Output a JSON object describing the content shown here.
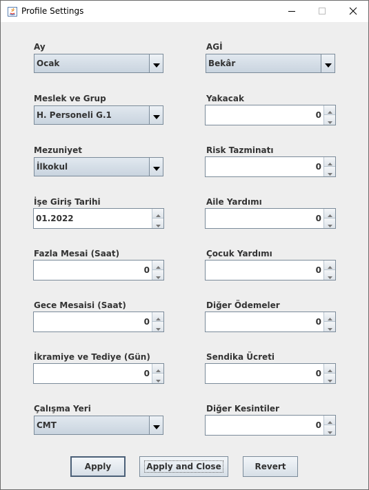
{
  "window": {
    "title": "Profile Settings"
  },
  "fields": {
    "ay": {
      "label": "Ay",
      "value": "Ocak"
    },
    "agi": {
      "label": "AGİ",
      "value": "Bekâr"
    },
    "meslek": {
      "label": "Meslek ve Grup",
      "value": "H. Personeli G.1"
    },
    "yakacak": {
      "label": "Yakacak",
      "value": "0"
    },
    "mezuniyet": {
      "label": "Mezuniyet",
      "value": "İlkokul"
    },
    "risk": {
      "label": "Risk Tazminatı",
      "value": "0"
    },
    "ise_giris": {
      "label": "İşe Giriş Tarihi",
      "value": "01.2022"
    },
    "aile": {
      "label": "Aile Yardımı",
      "value": "0"
    },
    "fazla_mesai": {
      "label": "Fazla Mesai (Saat)",
      "value": "0"
    },
    "cocuk": {
      "label": "Çocuk Yardımı",
      "value": "0"
    },
    "gece_mesai": {
      "label": "Gece Mesaisi (Saat)",
      "value": "0"
    },
    "diger_odemeler": {
      "label": "Diğer Ödemeler",
      "value": "0"
    },
    "ikramiye": {
      "label": "İkramiye ve Tediye (Gün)",
      "value": "0"
    },
    "sendika": {
      "label": "Sendika Ücreti",
      "value": "0"
    },
    "calisma_yeri": {
      "label": "Çalışma Yeri",
      "value": "CMT"
    },
    "diger_kesintiler": {
      "label": "Diğer Kesintiler",
      "value": "0"
    }
  },
  "buttons": {
    "apply": "Apply",
    "apply_close": "Apply and Close",
    "revert": "Revert"
  }
}
